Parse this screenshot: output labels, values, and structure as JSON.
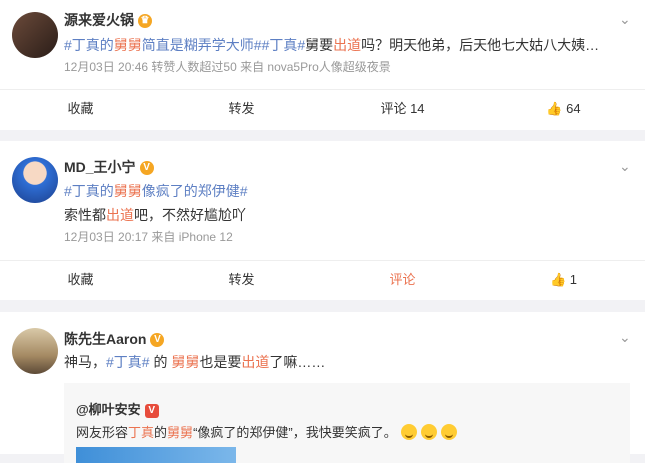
{
  "posts": [
    {
      "username": "源来爱火锅",
      "content": [
        {
          "t": "#丁真的",
          "c": "tp"
        },
        {
          "t": "舅舅",
          "c": "hl"
        },
        {
          "t": "简直是糊弄学大师#",
          "c": "tp"
        },
        {
          "t": "#丁真#",
          "c": "tp"
        },
        {
          "t": "舅要",
          "c": ""
        },
        {
          "t": "出道",
          "c": "hl"
        },
        {
          "t": "吗？明天他弟，后天他七大姑八大姨…",
          "c": ""
        }
      ],
      "meta": "12月03日 20:46 转赞人数超过50  来自 nova5Pro人像超级夜景",
      "actions": {
        "collect": "收藏",
        "repost": "转发",
        "comment": "评论 14",
        "like": "64"
      }
    },
    {
      "username": "MD_王小宁",
      "content_line1": [
        {
          "t": "#丁真",
          "c": "tp"
        },
        {
          "t": "的",
          "c": "tp"
        },
        {
          "t": "舅舅",
          "c": "hl"
        },
        {
          "t": "像疯了的郑伊健#",
          "c": "tp"
        }
      ],
      "content_line2": [
        {
          "t": "索性都",
          "c": ""
        },
        {
          "t": "出道",
          "c": "hl"
        },
        {
          "t": "吧，不然好尴尬吖",
          "c": ""
        }
      ],
      "meta": "12月03日 20:17  来自 iPhone 12",
      "actions": {
        "collect": "收藏",
        "repost": "转发",
        "comment": "评论",
        "like": "1"
      }
    },
    {
      "username": "陈先生Aaron",
      "content": [
        {
          "t": "神马，",
          "c": ""
        },
        {
          "t": "#丁真#",
          "c": "tp"
        },
        {
          "t": " 的 ",
          "c": ""
        },
        {
          "t": "舅舅",
          "c": "hl"
        },
        {
          "t": "也是要",
          "c": ""
        },
        {
          "t": "出道",
          "c": "hl"
        },
        {
          "t": "了嘛……",
          "c": ""
        }
      ],
      "quote": {
        "author": "@柳叶安安",
        "text": [
          {
            "t": "网友形容",
            "c": ""
          },
          {
            "t": "丁真",
            "c": "hl"
          },
          {
            "t": "的",
            "c": ""
          },
          {
            "t": "舅舅",
            "c": "hl"
          },
          {
            "t": "“像疯了的郑伊健”，我快要笑疯了。",
            "c": ""
          }
        ]
      }
    }
  ]
}
